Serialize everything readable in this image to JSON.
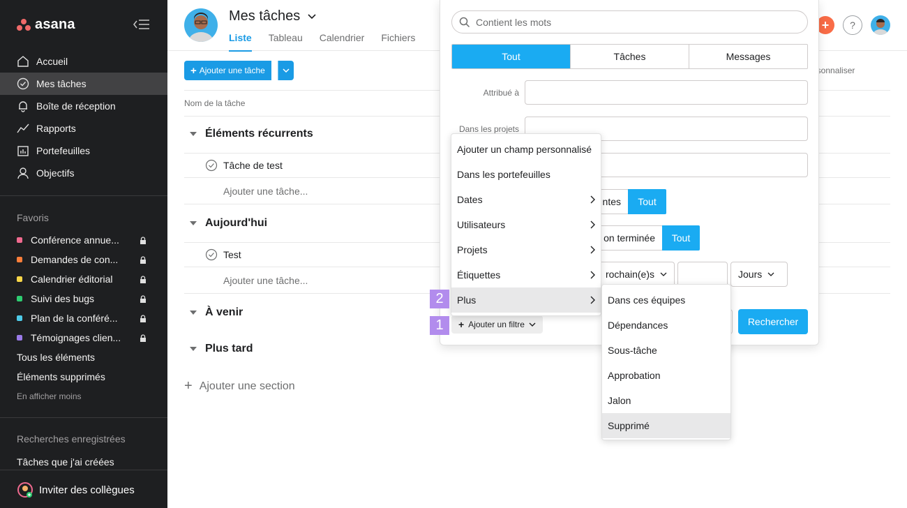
{
  "app": {
    "logo_text": "asana"
  },
  "sidebar": {
    "nav": [
      {
        "label": "Accueil",
        "icon": "home-icon"
      },
      {
        "label": "Mes tâches",
        "icon": "check-circle-icon",
        "active": true
      },
      {
        "label": "Boîte de réception",
        "icon": "bell-icon"
      },
      {
        "label": "Rapports",
        "icon": "chart-line-icon"
      },
      {
        "label": "Portefeuilles",
        "icon": "portfolio-icon"
      },
      {
        "label": "Objectifs",
        "icon": "person-icon"
      }
    ],
    "favorites_title": "Favoris",
    "favorites": [
      {
        "label": "Conférence annue...",
        "color": "#f06a8f"
      },
      {
        "label": "Demandes de con...",
        "color": "#fd7e3a"
      },
      {
        "label": "Calendrier éditorial",
        "color": "#f8d648"
      },
      {
        "label": "Suivi des bugs",
        "color": "#2ecc71"
      },
      {
        "label": "Plan de la conféré...",
        "color": "#4ecbe8"
      },
      {
        "label": "Témoignages clien...",
        "color": "#9a7ae8"
      }
    ],
    "all_items": "Tous les éléments",
    "deleted_items": "Éléments supprimés",
    "show_less": "En afficher moins",
    "saved_searches_title": "Recherches enregistrées",
    "saved_search_1": "Tâches que j'ai créées",
    "invite": "Inviter des collègues"
  },
  "header": {
    "title": "Mes tâches",
    "tabs": [
      "Liste",
      "Tableau",
      "Calendrier",
      "Fichiers"
    ],
    "help": "?"
  },
  "toolbar": {
    "add_task": "Ajouter une tâche",
    "personalize": "ersonnaliser"
  },
  "list": {
    "column_task_name": "Nom de la tâche",
    "sections": [
      {
        "title": "Éléments récurrents",
        "tasks": [
          "Tâche de test"
        ],
        "add": "Ajouter une tâche..."
      },
      {
        "title": "Aujourd'hui",
        "tasks": [
          "Test"
        ],
        "add": "Ajouter une tâche..."
      },
      {
        "title": "À venir"
      },
      {
        "title": "Plus tard"
      }
    ],
    "add_section": "Ajouter une section"
  },
  "search": {
    "placeholder": "Contient les mots",
    "segments": [
      "Tout",
      "Tâches",
      "Messages"
    ],
    "assigned_label": "Attribué à",
    "in_projects_label": "Dans les projets",
    "chip1_partial": "ntes",
    "chip1_on": "Tout",
    "chip2_partial": "on terminée",
    "chip2_on": "Tout",
    "next_partial": "rochain(e)s",
    "days": "Jours",
    "search_button": "Rechercher",
    "add_filter": "Ajouter un filtre"
  },
  "filter_menu": {
    "items": [
      "Ajouter un champ personnalisé",
      "Dans les portefeuilles",
      "Dates",
      "Utilisateurs",
      "Projets",
      "Étiquettes",
      "Plus"
    ]
  },
  "more_menu": {
    "items": [
      "Dans ces équipes",
      "Dépendances",
      "Sous-tâche",
      "Approbation",
      "Jalon",
      "Supprimé"
    ]
  },
  "badges": [
    "2",
    "1"
  ]
}
